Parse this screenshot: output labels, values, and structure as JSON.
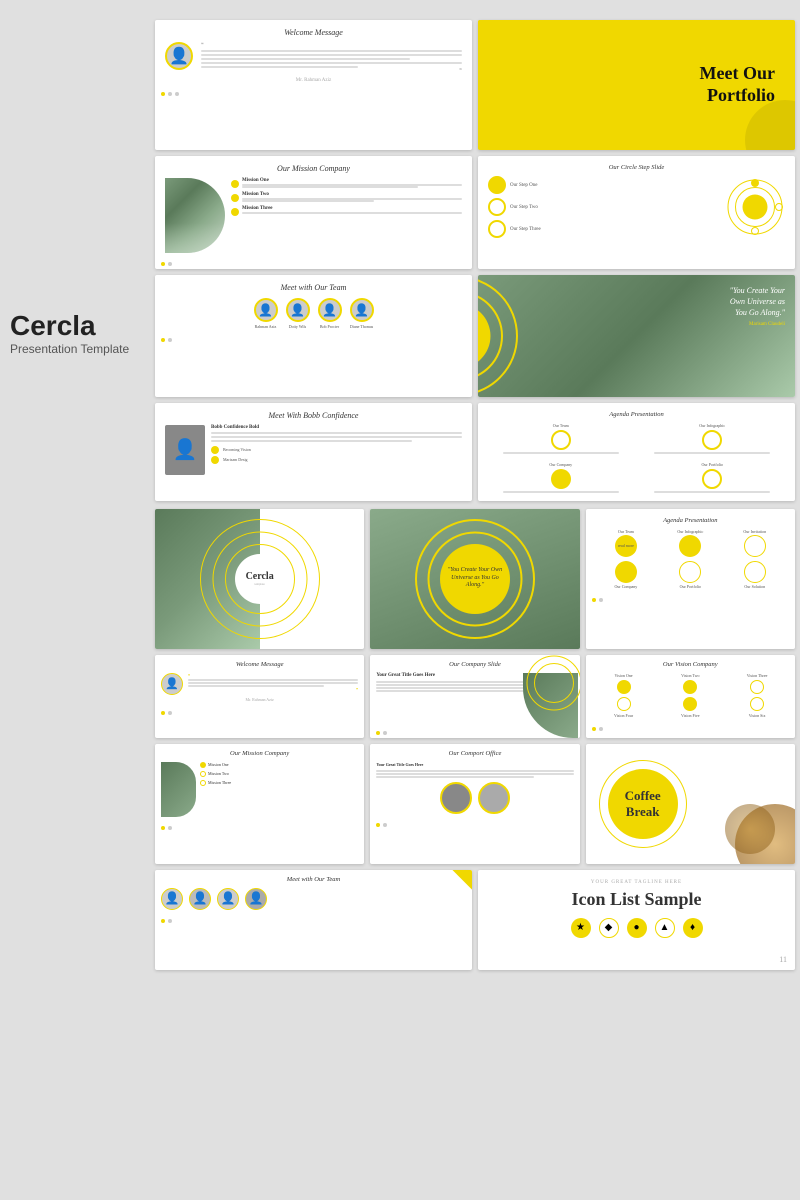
{
  "sidebar": {
    "title": "Cercla",
    "subtitle": "Presentation Template"
  },
  "slides": {
    "welcome_message": "Welcome Message",
    "meet_portfolio": "Meet Our Portfolio",
    "our_mission": "Our Mission Company",
    "circle_step": "Our Circle Step Slide",
    "meet_team": "Meet with Our Team",
    "you_create_quote": "\"You Create Your Own Universe as You Go Along.\"",
    "meet_bobb": "Meet With Bobb Confidence",
    "agenda_presentation": "Agenda Presentation",
    "cercla_title": "Cercla",
    "company_slide": "Our Company Slide",
    "vision_company": "Our Vision Company",
    "welcome_message2": "Welcome Message",
    "our_mission2": "Our Mission Company",
    "comport_office": "Our Comport Office",
    "coffee_break": "Coffee Break",
    "meet_team2": "Meet with Our Team",
    "icon_list": "Icon List Sample",
    "your_great": "YOUR GREAT TAGLINE HERE"
  },
  "colors": {
    "yellow": "#f0d800",
    "dark": "#222222",
    "gray": "#888888",
    "light_gray": "#e0e0e0",
    "white": "#ffffff"
  },
  "icons": {
    "quote_open": "“",
    "quote_close": "”",
    "person": "👤"
  }
}
